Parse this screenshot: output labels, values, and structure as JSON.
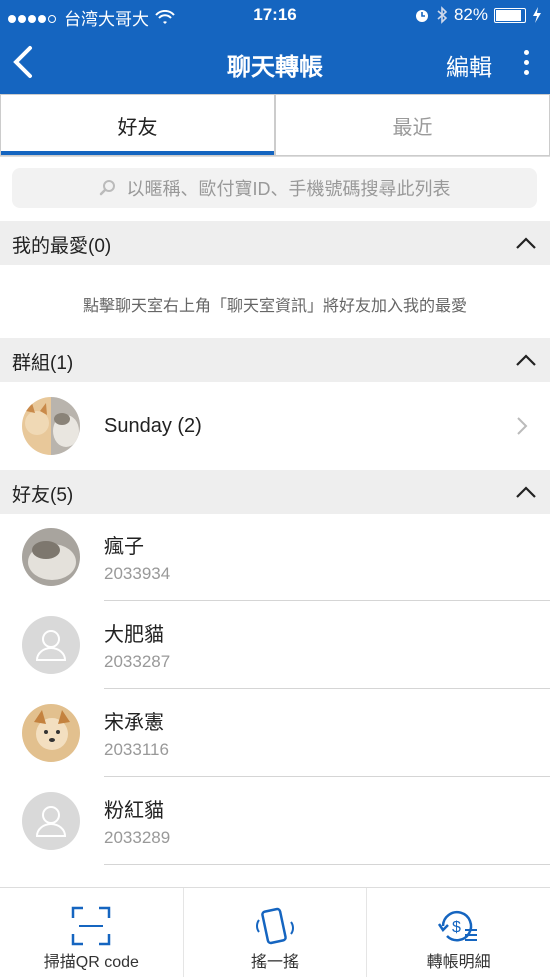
{
  "status": {
    "carrier": "台湾大哥大",
    "time": "17:16",
    "battery": "82%"
  },
  "header": {
    "title": "聊天轉帳",
    "edit": "編輯"
  },
  "tabs": [
    {
      "label": "好友"
    },
    {
      "label": "最近"
    }
  ],
  "search": {
    "placeholder": "以暱稱、歐付寶ID、手機號碼搜尋此列表"
  },
  "favorites": {
    "label": "我的最愛(0)",
    "hint": "點擊聊天室右上角「聊天室資訊」將好友加入我的最愛"
  },
  "groups": {
    "label": "群組(1)",
    "items": [
      {
        "name": "Sunday (2)"
      }
    ]
  },
  "friends": {
    "label": "好友(5)",
    "items": [
      {
        "name": "瘋子",
        "id": "2033934"
      },
      {
        "name": "大肥貓",
        "id": "2033287"
      },
      {
        "name": "宋承憲",
        "id": "2033116"
      },
      {
        "name": "粉紅貓",
        "id": "2033289"
      }
    ]
  },
  "bottom": {
    "scan": "掃描QR code",
    "shake": "搖一搖",
    "history": "轉帳明細"
  },
  "colors": {
    "primary": "#1565c0"
  }
}
